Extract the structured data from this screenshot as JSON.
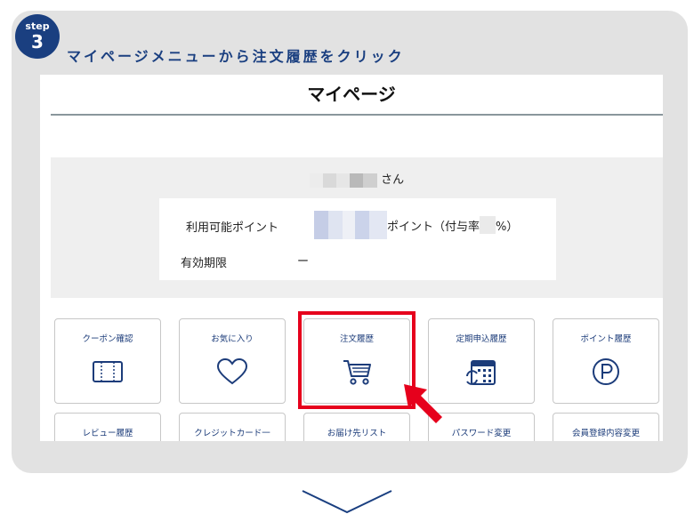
{
  "step": {
    "word": "step",
    "number": "3"
  },
  "instruction": "マイページメニューから注文履歴をクリック",
  "page": {
    "title": "マイページ"
  },
  "user": {
    "suffix": "さん"
  },
  "points": {
    "label": "利用可能ポイント",
    "unit_text": "ポイント（付与率",
    "rate_suffix": "%）",
    "expiry_label": "有効期限",
    "expiry_value": "ー"
  },
  "menu": {
    "row1": [
      {
        "label": "クーポン確認",
        "icon": "coupon-book-icon"
      },
      {
        "label": "お気に入り",
        "icon": "heart-icon"
      },
      {
        "label": "注文履歴",
        "icon": "cart-icon"
      },
      {
        "label": "定期申込履歴",
        "icon": "calendar-repeat-icon"
      },
      {
        "label": "ポイント履歴",
        "icon": "point-p-icon"
      }
    ],
    "row2": [
      {
        "label": "レビュー履歴"
      },
      {
        "label": "クレジットカード一"
      },
      {
        "label": "お届け先リスト"
      },
      {
        "label": "パスワード変更"
      },
      {
        "label": "会員登録内容変更"
      }
    ]
  },
  "colors": {
    "brand": "#1a3f80",
    "highlight": "#e6001c",
    "icon": "#1c3c7a"
  }
}
